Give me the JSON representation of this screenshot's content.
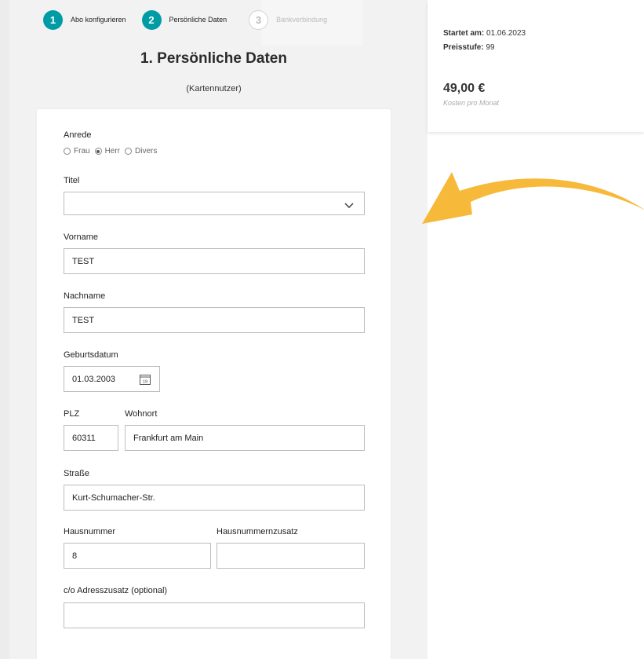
{
  "stepper": {
    "steps": [
      {
        "num": "1",
        "label": "Abo konfigurieren",
        "state": "done"
      },
      {
        "num": "2",
        "label": "Persönliche Daten",
        "state": "active"
      },
      {
        "num": "3",
        "label": "Bankverbindung",
        "state": "inactive"
      }
    ]
  },
  "page": {
    "title": "1. Persönliche Daten",
    "subtitle": "(Kartennutzer)"
  },
  "form": {
    "anrede_label": "Anrede",
    "anrede_options": [
      "Frau",
      "Herr",
      "Divers"
    ],
    "anrede_selected": "Herr",
    "titel_label": "Titel",
    "titel_value": "",
    "vorname_label": "Vorname",
    "vorname_value": "TEST",
    "nachname_label": "Nachname",
    "nachname_value": "TEST",
    "geburtsdatum_label": "Geburtsdatum",
    "geburtsdatum_value": "01.03.2003",
    "calendar_icon_text": "19",
    "plz_label": "PLZ",
    "plz_value": "60311",
    "wohnort_label": "Wohnort",
    "wohnort_value": "Frankfurt am Main",
    "strasse_label": "Straße",
    "strasse_value": "Kurt-Schumacher-Str.",
    "hausnummer_label": "Hausnummer",
    "hausnummer_value": "8",
    "hausnummerzusatz_label": "Hausnummernzusatz",
    "hausnummerzusatz_value": "",
    "adresszusatz_label": "c/o Adresszusatz (optional)",
    "adresszusatz_value": ""
  },
  "summary": {
    "start_label": "Startet am:",
    "start_value": "01.06.2023",
    "preis_label": "Preisstufe:",
    "preis_value": "99",
    "price": "49,00 €",
    "price_sub": "Kosten pro Monat"
  },
  "colors": {
    "accent": "#009ca6",
    "arrow": "#f7b93a",
    "background": "#f2f2f2"
  },
  "icons": [
    "chevron-down-icon",
    "calendar-icon",
    "arrow-annotation-icon"
  ]
}
